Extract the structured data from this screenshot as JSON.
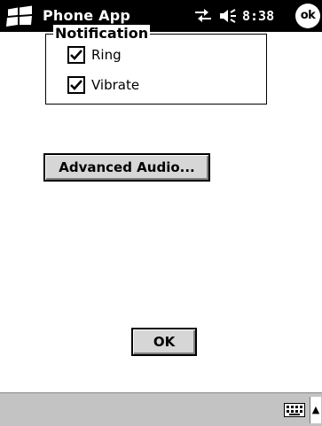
{
  "titlebar": {
    "app_title": "Phone App",
    "time": "8:38",
    "ok_label": "ok",
    "start_icon": "windows-flag-icon",
    "connectivity_icon": "connectivity-icon",
    "volume_icon": "speaker-icon"
  },
  "notification": {
    "group_label": "Notification",
    "options": [
      {
        "label": "Ring",
        "checked": true
      },
      {
        "label": "Vibrate",
        "checked": true
      }
    ]
  },
  "buttons": {
    "advanced_audio": "Advanced Audio...",
    "ok": "OK"
  },
  "menubar": {
    "keyboard_icon": "keyboard-icon",
    "sip_arrow": "▲"
  }
}
